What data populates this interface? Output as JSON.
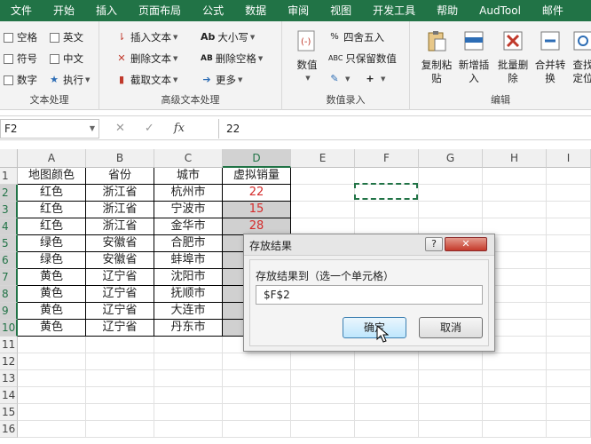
{
  "menu": [
    "文件",
    "开始",
    "插入",
    "页面布局",
    "公式",
    "数据",
    "审阅",
    "视图",
    "开发工具",
    "帮助",
    "AudTool",
    "邮件"
  ],
  "ribbon": {
    "text_group": {
      "items": [
        "空格",
        "英文",
        "符号",
        "中文",
        "数字",
        "执行"
      ],
      "label": "文本处理"
    },
    "adv_group": {
      "insert": "插入文本",
      "case": "大小写",
      "delete": "删除文本",
      "del_space": "删除空格",
      "extract": "截取文本",
      "more": "更多",
      "label": "高级文本处理"
    },
    "num_group": {
      "value": "数值",
      "round": "四舍五入",
      "keep": "只保留数值",
      "label": "数值录入"
    },
    "edit_group": {
      "copy_paste": "复制粘贴",
      "new_insert": "新增插入",
      "batch_delete": "批量删除",
      "merge": "合并转换",
      "find": "查找定位",
      "label": "编辑"
    }
  },
  "formula_bar": {
    "name_box": "F2",
    "fx": "fx",
    "value": "22"
  },
  "columns": [
    "A",
    "B",
    "C",
    "D",
    "E",
    "F",
    "G",
    "H",
    "I"
  ],
  "rows": [
    "1",
    "2",
    "3",
    "4",
    "5",
    "6",
    "7",
    "8",
    "9",
    "10",
    "11",
    "12",
    "13",
    "14",
    "15",
    "16"
  ],
  "table": {
    "headers": [
      "地图颜色",
      "省份",
      "城市",
      "虚拟销量"
    ],
    "rows": [
      [
        "红色",
        "浙江省",
        "杭州市",
        "22"
      ],
      [
        "红色",
        "浙江省",
        "宁波市",
        "15"
      ],
      [
        "红色",
        "浙江省",
        "金华市",
        "28"
      ],
      [
        "绿色",
        "安徽省",
        "合肥市",
        ""
      ],
      [
        "绿色",
        "安徽省",
        "蚌埠市",
        ""
      ],
      [
        "黄色",
        "辽宁省",
        "沈阳市",
        ""
      ],
      [
        "黄色",
        "辽宁省",
        "抚顺市",
        ""
      ],
      [
        "黄色",
        "辽宁省",
        "大连市",
        ""
      ],
      [
        "黄色",
        "辽宁省",
        "丹东市",
        ""
      ]
    ]
  },
  "dialog": {
    "title": "存放结果",
    "help": "?",
    "close": "✕",
    "prompt": "存放结果到（选一个单元格）",
    "input_value": "$F$2",
    "ok": "确定",
    "cancel": "取消"
  },
  "colors": {
    "brand": "#217346",
    "red_value": "#d42b2b"
  }
}
